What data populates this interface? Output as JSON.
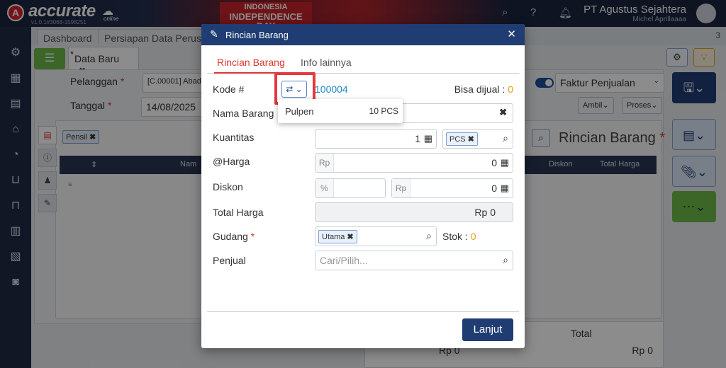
{
  "app": {
    "logo_letter": "A",
    "logo_text": "accurate",
    "logo_sub": "online",
    "version": "v1.0.1#3068-1598251",
    "banner_line1": "INDONESIA",
    "banner_line2": "INDEPENDENCE DAY",
    "company": "PT Agustus Sejahtera",
    "user": "Michel Aprillaaaa"
  },
  "page_tabs": [
    "Dashboard",
    "Persiapan Data Perusa"
  ],
  "tab_count": "3",
  "doc_tab": {
    "star": "*",
    "label": "Data Baru",
    "close": "✖"
  },
  "form": {
    "pelanggan_label": "Pelanggan",
    "pelanggan_value": "[C.00001] Abad",
    "tanggal_label": "Tanggal",
    "tanggal_value": "14/08/2025",
    "faktur_label": "Faktur Penjualan",
    "ambil_label": "Ambil",
    "proses_label": "Proses",
    "filter_chip": "Pensil",
    "grid_col_name": "Nam",
    "grid_col_diskon": "Diskon",
    "grid_col_total": "Total Harga",
    "section_title": "Rincian Barang",
    "total_label": "Total",
    "bottom_rp_1": "Rp 0",
    "bottom_rp_2": "Rp 0"
  },
  "modal": {
    "title": "Rincian Barang",
    "tabs": [
      "Rincian Barang",
      "Info lainnya"
    ],
    "kode_label": "Kode #",
    "kode_value": "100004",
    "bisa_dijual_label": "Bisa dijual :",
    "bisa_dijual_value": "0",
    "dropdown_item_name": "Pulpen",
    "dropdown_item_qty": "10 PCS",
    "nama_label": "Nama Barang",
    "kuantitas_label": "Kuantitas",
    "kuantitas_value": "1",
    "unit_chip": "PCS",
    "harga_label": "@Harga",
    "harga_prefix": "Rp",
    "harga_value": "0",
    "diskon_label": "Diskon",
    "diskon_pct_prefix": "%",
    "diskon_rp_prefix": "Rp",
    "diskon_value": "0",
    "total_label": "Total Harga",
    "total_value": "Rp 0",
    "gudang_label": "Gudang",
    "gudang_chip": "Utama",
    "stok_label": "Stok :",
    "stok_value": "0",
    "penjual_label": "Penjual",
    "penjual_placeholder": "Cari/Pilih...",
    "lanjut_label": "Lanjut"
  },
  "colors": {
    "primary": "#1f3d73",
    "accent_red": "#d9382f",
    "link_blue": "#1e88c8",
    "orange": "#e0a21b",
    "green": "#6dbb4a"
  }
}
